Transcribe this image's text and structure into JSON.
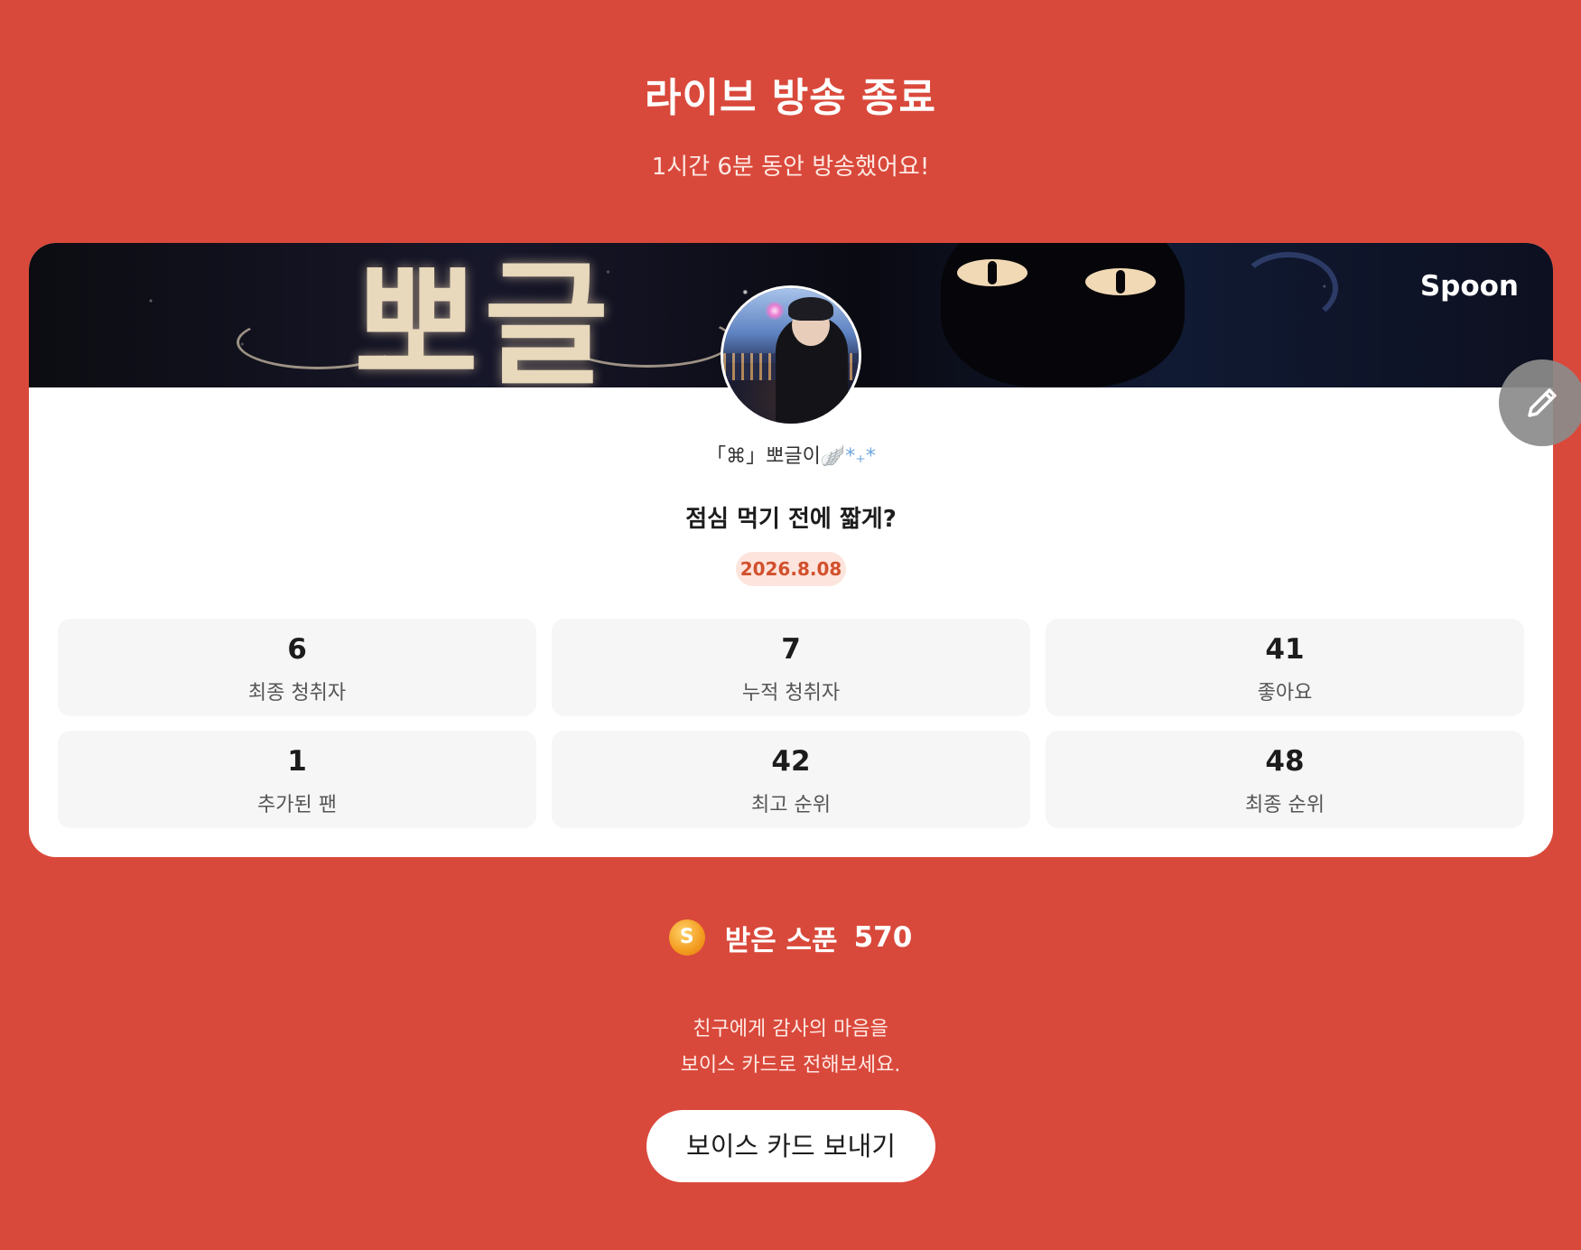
{
  "header": {
    "title": "라이브 방송 종료",
    "subtitle": "1시간 6분 동안 방송했어요!"
  },
  "banner": {
    "brand": "Spoon",
    "artwork_text": "뽀글"
  },
  "profile": {
    "nickname": "「⌘」뽀글이",
    "nickname_decor": "🪽*₊*"
  },
  "broadcast": {
    "title": "점심 먹기 전에 짧게?",
    "date": "2026.8.08"
  },
  "stats": [
    {
      "value": "6",
      "label": "최종 청취자"
    },
    {
      "value": "7",
      "label": "누적 청취자"
    },
    {
      "value": "41",
      "label": "좋아요"
    },
    {
      "value": "1",
      "label": "추가된 팬"
    },
    {
      "value": "42",
      "label": "최고 순위"
    },
    {
      "value": "48",
      "label": "최종 순위"
    }
  ],
  "spoons": {
    "coin_symbol": "S",
    "label": "받은 스푼",
    "count": "570"
  },
  "thanks": {
    "line1": "친구에게 감사의 마음을",
    "line2": "보이스 카드로 전해보세요."
  },
  "buttons": {
    "voice_card": "보이스 카드 보내기"
  },
  "icons": {
    "edit": "pencil-icon",
    "coin": "spoon-coin-icon"
  },
  "colors": {
    "background": "#d9493b",
    "card": "#ffffff",
    "stat_tile": "#f6f6f6",
    "date_badge_bg": "#fde4dc",
    "date_badge_text": "#d2502d"
  }
}
